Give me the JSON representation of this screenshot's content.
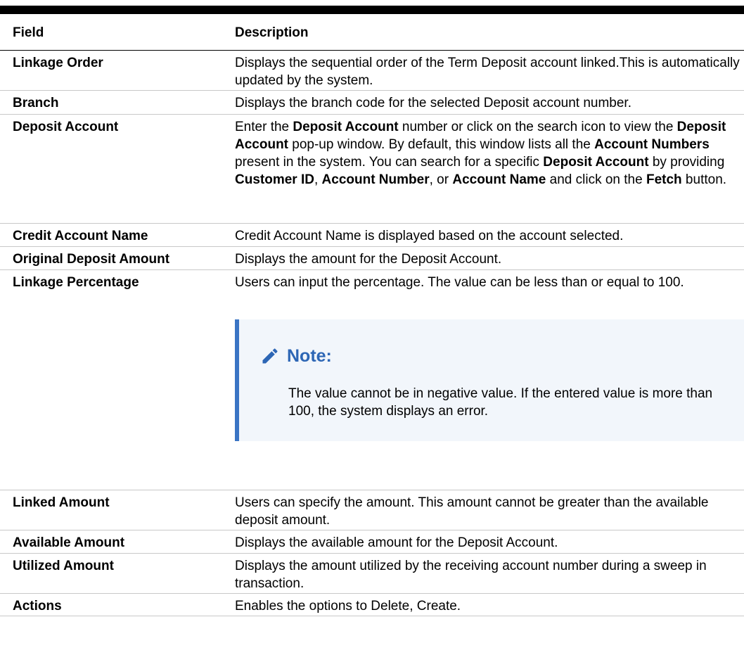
{
  "table": {
    "header": {
      "field": "Field",
      "description": "Description"
    },
    "rows": [
      {
        "field": "Linkage Order",
        "description": "Displays the sequential order of the Term Deposit account linked.This is automatically updated by the system."
      },
      {
        "field": "Branch",
        "description": "Displays the branch code for the selected Deposit account number."
      },
      {
        "field": "Deposit Account",
        "description_parts": [
          {
            "t": "Enter the "
          },
          {
            "t": "Deposit Account",
            "b": true
          },
          {
            "t": " number or click on the search icon to view the "
          },
          {
            "t": "Deposit Account",
            "b": true
          },
          {
            "t": " pop-up window. By default, this window lists all the "
          },
          {
            "t": "Account Numbers",
            "b": true
          },
          {
            "t": " present in the system. You can search for a specific "
          },
          {
            "t": "Deposit Account",
            "b": true
          },
          {
            "t": " by providing "
          },
          {
            "t": "Customer ID",
            "b": true
          },
          {
            "t": ", "
          },
          {
            "t": "Account Number",
            "b": true
          },
          {
            "t": ", or "
          },
          {
            "t": "Account Name",
            "b": true
          },
          {
            "t": " and click on the "
          },
          {
            "t": "Fetch",
            "b": true
          },
          {
            "t": " button."
          }
        ]
      },
      {
        "field": "Credit Account Name",
        "description": "Credit Account Name is displayed based on the account selected."
      },
      {
        "field": "Original Deposit Amount",
        "description": "Displays the amount for the Deposit Account."
      },
      {
        "field": "Linkage Percentage",
        "description": "Users can input the percentage. The value can be less than or equal to 100.",
        "note": {
          "icon": "pencil-icon",
          "title": "Note:",
          "text": "The value cannot be in negative value. If the entered value is more than 100, the system displays an error."
        }
      },
      {
        "field": "Linked Amount",
        "description": "Users can specify the amount. This amount cannot be greater than the available deposit amount."
      },
      {
        "field": "Available Amount",
        "description": "Displays the available amount for the Deposit Account."
      },
      {
        "field": "Utilized Amount",
        "description": "Displays the amount utilized by the receiving account number during a sweep in transaction."
      },
      {
        "field": "Actions",
        "description": "Enables the options to Delete, Create."
      }
    ]
  },
  "colors": {
    "note_accent": "#3a74c4",
    "note_title": "#2d66b5",
    "note_background": "#f2f6fb"
  }
}
